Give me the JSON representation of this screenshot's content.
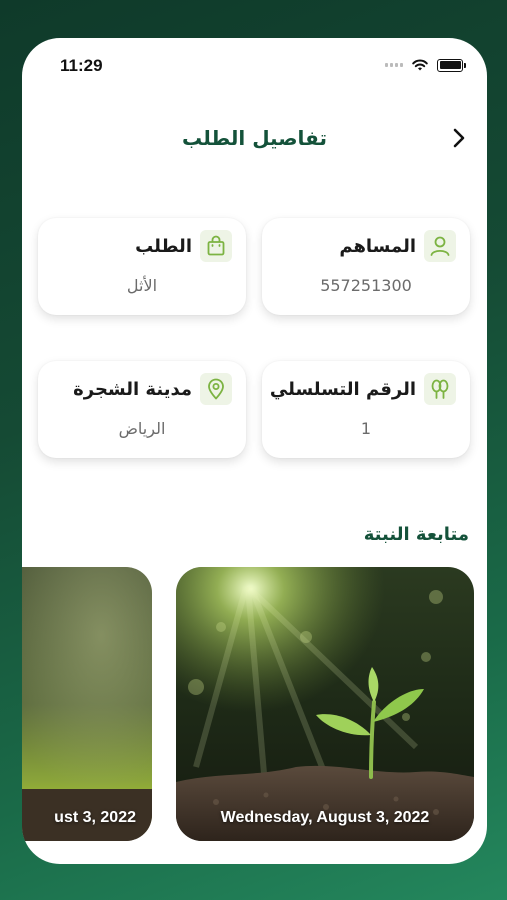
{
  "status_bar": {
    "time": "11:29"
  },
  "header": {
    "title": "تفاصيل الطلب"
  },
  "cards": [
    {
      "title": "المساهم",
      "value": "557251300",
      "icon": "user-icon"
    },
    {
      "title": "الطلب",
      "value": "الأثل",
      "icon": "shopping-bag-icon"
    },
    {
      "title": "الرقم التسلسلي",
      "value": "1",
      "icon": "trees-icon"
    },
    {
      "title": "مدينة الشجرة",
      "value": "الرياض",
      "icon": "location-pin-icon"
    }
  ],
  "tracking": {
    "title": "متابعة النبتة",
    "photos": [
      {
        "date": "Wednesday, August 3, 2022"
      },
      {
        "date": "ust 3, 2022"
      }
    ]
  },
  "colors": {
    "accent": "#14523a",
    "icon_green": "#7cb342",
    "icon_bg": "#eef4e6"
  }
}
